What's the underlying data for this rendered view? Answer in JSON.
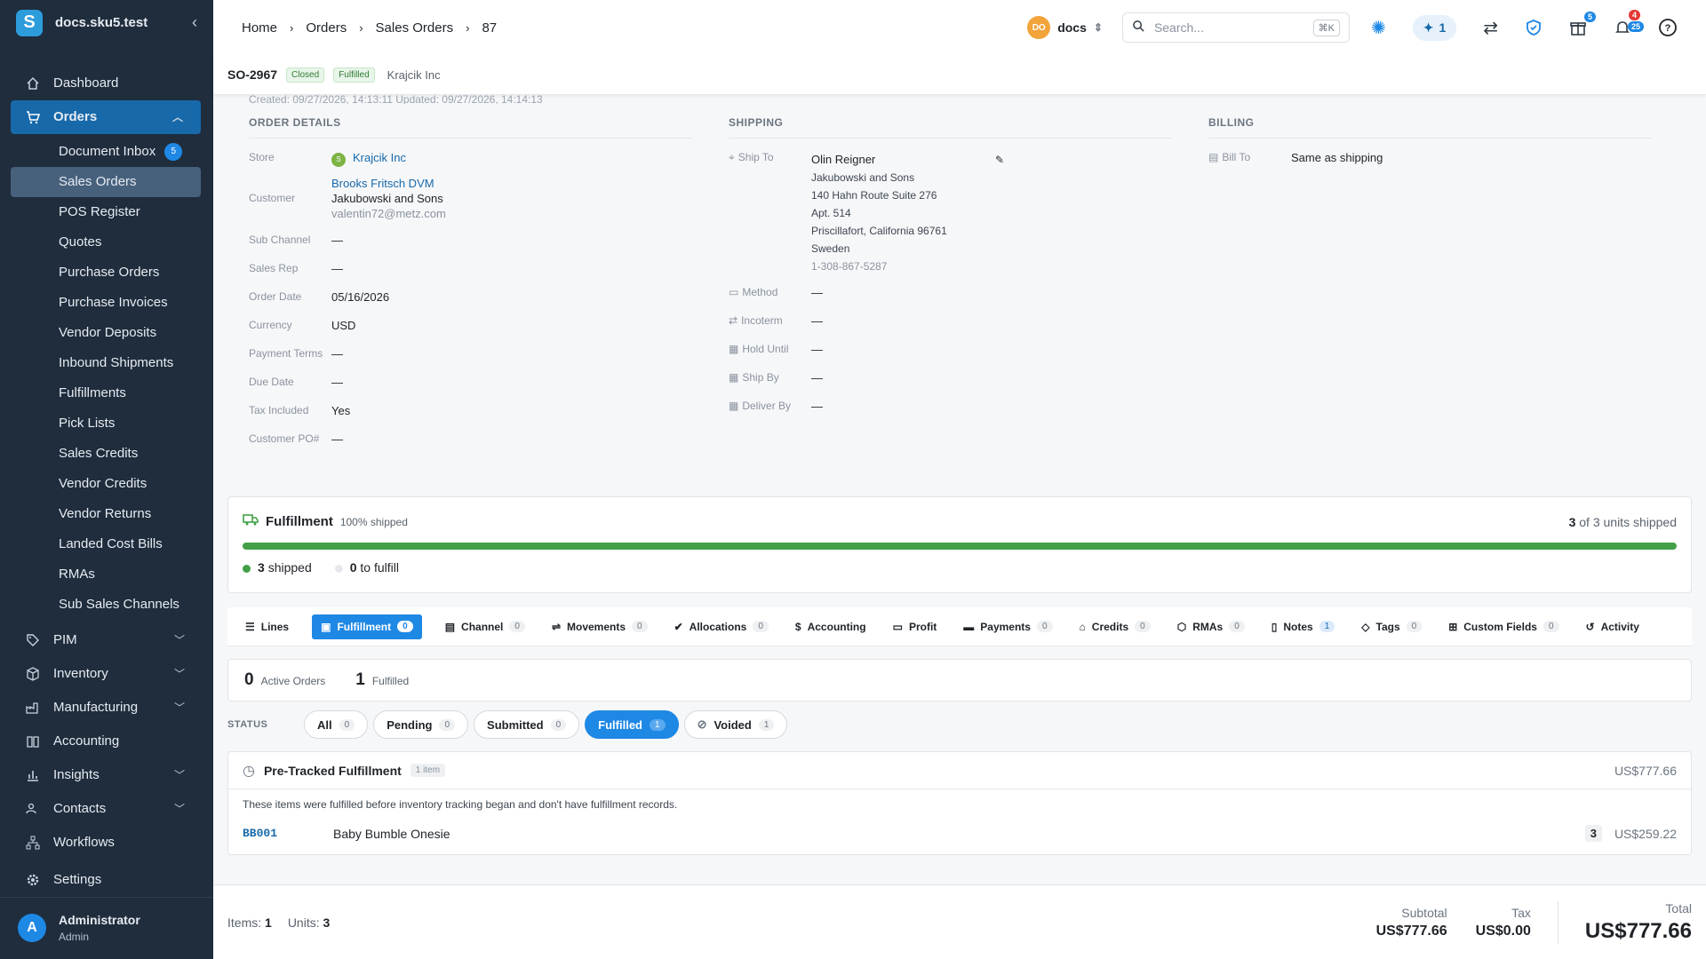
{
  "sidebar": {
    "brand": "docs.sku5.test",
    "logo_letter": "S",
    "items": [
      {
        "label": "Dashboard",
        "icon": "home-icon"
      },
      {
        "label": "Orders",
        "icon": "cart-icon"
      },
      {
        "label": "PIM",
        "icon": "tag-icon"
      },
      {
        "label": "Inventory",
        "icon": "box-icon"
      },
      {
        "label": "Manufacturing",
        "icon": "factory-icon"
      },
      {
        "label": "Accounting",
        "icon": "book-icon"
      },
      {
        "label": "Insights",
        "icon": "chart-icon"
      },
      {
        "label": "Contacts",
        "icon": "people-icon"
      },
      {
        "label": "Workflows",
        "icon": "workflow-icon"
      },
      {
        "label": "Settings",
        "icon": "gear-icon"
      }
    ],
    "orders_sub": [
      {
        "label": "Document Inbox",
        "badge": "5"
      },
      {
        "label": "Sales Orders"
      },
      {
        "label": "POS Register"
      },
      {
        "label": "Quotes"
      },
      {
        "label": "Purchase Orders"
      },
      {
        "label": "Purchase Invoices"
      },
      {
        "label": "Vendor Deposits"
      },
      {
        "label": "Inbound Shipments"
      },
      {
        "label": "Fulfillments"
      },
      {
        "label": "Pick Lists"
      },
      {
        "label": "Sales Credits"
      },
      {
        "label": "Vendor Credits"
      },
      {
        "label": "Vendor Returns"
      },
      {
        "label": "Landed Cost Bills"
      },
      {
        "label": "RMAs"
      },
      {
        "label": "Sub Sales Channels"
      }
    ],
    "user": {
      "initial": "A",
      "name": "Administrator",
      "role": "Admin"
    }
  },
  "topbar": {
    "breadcrumbs": [
      "Home",
      "Orders",
      "Sales Orders",
      "87"
    ],
    "workspace": {
      "initials": "DO",
      "name": "docs"
    },
    "search_placeholder": "Search...",
    "search_shortcut": "⌘K",
    "ai_count": "1",
    "gift_badge": "5",
    "notif_badge_red": "4",
    "notif_badge_blue": "25"
  },
  "order": {
    "number": "SO-2967",
    "status_1": "Closed",
    "status_2": "Fulfilled",
    "customer_name": "Krajcik Inc",
    "meta": "Created: 09/27/2026, 14:13:11    Updated: 09/27/2026, 14:14:13"
  },
  "details": {
    "heading": "ORDER DETAILS",
    "store_label": "Store",
    "store_initial": "S",
    "store": "Krajcik Inc",
    "customer_label": "Customer",
    "customer": "Brooks Fritsch DVM",
    "customer_company": "Jakubowski and Sons",
    "customer_email": "valentin72@metz.com",
    "sub_channel_label": "Sub Channel",
    "sub_channel": "—",
    "sales_rep_label": "Sales Rep",
    "sales_rep": "—",
    "order_date_label": "Order Date",
    "order_date": "05/16/2026",
    "currency_label": "Currency",
    "currency": "USD",
    "payment_terms_label": "Payment Terms",
    "payment_terms": "—",
    "due_date_label": "Due Date",
    "due_date": "—",
    "tax_included_label": "Tax Included",
    "tax_included": "Yes",
    "customer_po_label": "Customer PO#",
    "customer_po": "—"
  },
  "shipping": {
    "heading": "SHIPPING",
    "ship_to_label": "Ship To",
    "name": "Olin Reigner",
    "company": "Jakubowski and Sons",
    "address1": "140 Hahn Route Suite 276",
    "address2": "Apt. 514",
    "city_line": "Priscillafort, California 96761",
    "country": "Sweden",
    "phone": "1-308-867-5287",
    "method_label": "Method",
    "method": "—",
    "incoterm_label": "Incoterm",
    "incoterm": "—",
    "hold_until_label": "Hold Until",
    "hold_until": "—",
    "ship_by_label": "Ship By",
    "ship_by": "—",
    "deliver_by_label": "Deliver By",
    "deliver_by": "—"
  },
  "billing": {
    "heading": "BILLING",
    "bill_to_label": "Bill To",
    "bill_to": "Same as shipping"
  },
  "fulfillment": {
    "title": "Fulfillment",
    "percent_text": "100% shipped",
    "shipped_fraction": 1.0,
    "units_shipped": "3",
    "units_total_text": "of 3 units shipped",
    "shipped_count": "3",
    "shipped_label": "shipped",
    "to_fulfill_count": "0",
    "to_fulfill_label": "to fulfill"
  },
  "tabs": [
    {
      "label": "Lines",
      "icon": "list-icon"
    },
    {
      "label": "Fulfillment",
      "count": "0",
      "icon": "clipboard-icon"
    },
    {
      "label": "Channel",
      "count": "0",
      "icon": "store-icon"
    },
    {
      "label": "Movements",
      "count": "0",
      "icon": "arrows-icon"
    },
    {
      "label": "Allocations",
      "count": "0",
      "icon": "check-badge-icon"
    },
    {
      "label": "Accounting",
      "icon": "dollar-icon"
    },
    {
      "label": "Profit",
      "icon": "cash-icon"
    },
    {
      "label": "Payments",
      "count": "0",
      "icon": "card-icon"
    },
    {
      "label": "Credits",
      "count": "0",
      "icon": "bank-icon"
    },
    {
      "label": "RMAs",
      "count": "0",
      "icon": "return-box-icon"
    },
    {
      "label": "Notes",
      "count": "1",
      "icon": "note-icon"
    },
    {
      "label": "Tags",
      "count": "0",
      "icon": "tag-icon"
    },
    {
      "label": "Custom Fields",
      "count": "0",
      "icon": "fields-icon"
    },
    {
      "label": "Activity",
      "icon": "history-icon"
    }
  ],
  "summary": {
    "active_count": "0",
    "active_label": "Active Orders",
    "fulfilled_count": "1",
    "fulfilled_label": "Fulfilled"
  },
  "status_filter": {
    "label": "STATUS",
    "chips": [
      {
        "label": "All",
        "count": "0"
      },
      {
        "label": "Pending",
        "count": "0"
      },
      {
        "label": "Submitted",
        "count": "0"
      },
      {
        "label": "Fulfilled",
        "count": "1"
      },
      {
        "label": "Voided",
        "count": "1"
      }
    ]
  },
  "pretracked": {
    "title": "Pre-Tracked Fulfillment",
    "count_label": "1 item",
    "amount": "US$777.66",
    "note": "These items were fulfilled before inventory tracking began and don't have fulfillment records.",
    "line": {
      "sku": "BB001",
      "name": "Baby Bumble Onesie",
      "qty": "3",
      "price": "US$259.22"
    }
  },
  "footer": {
    "items_label": "Items:",
    "items": "1",
    "units_label": "Units:",
    "units": "3",
    "subtotal_label": "Subtotal",
    "subtotal": "US$777.66",
    "tax_label": "Tax",
    "tax": "US$0.00",
    "total_label": "Total",
    "total": "US$777.66"
  },
  "colors": {
    "sidebar_bg": "#1f2d3d",
    "accent": "#1e88e5",
    "progress": "#43a047"
  }
}
